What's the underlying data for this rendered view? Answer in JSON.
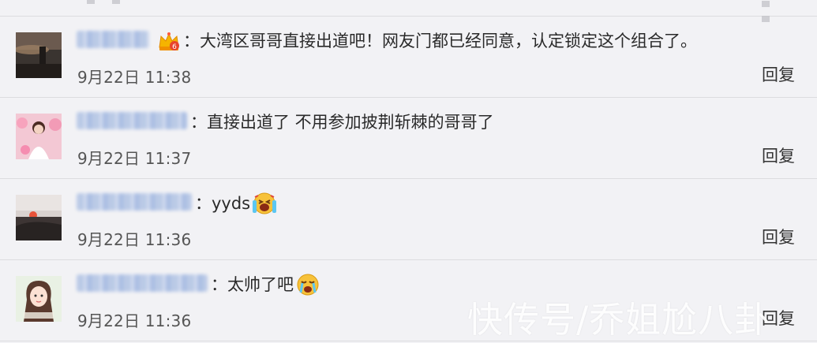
{
  "comments": [
    {
      "text": "：大湾区哥哥直接出道吧！网友门都已经同意，认定锁定这个组合了。",
      "time": "9月22日 11:38",
      "reply": "回复",
      "badge_icon": "vip-crown-badge-icon"
    },
    {
      "text": "：直接出道了  不用参加披荆斩棘的哥哥了",
      "time": "9月22日 11:37",
      "reply": "回复"
    },
    {
      "text": "：yyds",
      "time": "9月22日 11:36",
      "reply": "回复",
      "emoji_icon": "laugh-cry-emoji-icon"
    },
    {
      "text": "：太帅了吧",
      "time": "9月22日 11:36",
      "reply": "回复",
      "emoji_icon": "crying-emoji-icon"
    }
  ],
  "watermark": "快传号/乔姐尬八卦",
  "colors": {
    "background": "#f2f2f5",
    "divider": "#dcdcdf",
    "text": "#333333",
    "time": "#555555",
    "blurred_name": "#b8c8e6"
  }
}
